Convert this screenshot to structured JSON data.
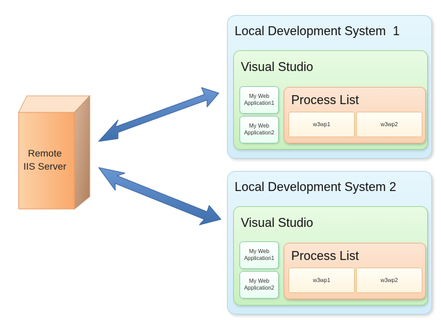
{
  "server": {
    "label_line1": "Remote",
    "label_line2": "IIS Server"
  },
  "systems": [
    {
      "title": "Local Development System  1",
      "vs_title": "Visual Studio",
      "apps": [
        {
          "line1": "My Web",
          "line2": "Application1"
        },
        {
          "line1": "My Web",
          "line2": "Application2"
        }
      ],
      "process_title": "Process List",
      "processes": [
        "w3wp1",
        "w3wp2"
      ]
    },
    {
      "title": "Local Development System 2",
      "vs_title": "Visual Studio",
      "apps": [
        {
          "line1": "My Web",
          "line2": "Application1"
        },
        {
          "line1": "My Web",
          "line2": "Application2"
        }
      ],
      "process_title": "Process List",
      "processes": [
        "w3wp1",
        "w3wp2"
      ]
    }
  ],
  "colors": {
    "server_front": "#fbb886",
    "server_side": "#c08a6a",
    "arrow": "#4a7ebb",
    "system_bg": "#dff3fc",
    "vs_bg": "#d4f5cc",
    "process_bg": "#fcdcc4"
  }
}
